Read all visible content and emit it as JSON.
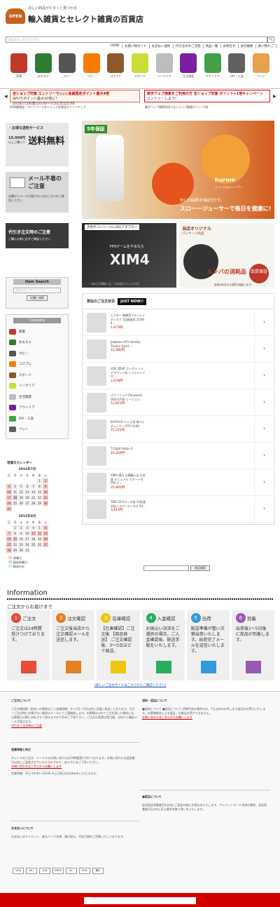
{
  "header": {
    "logo": "OPEN",
    "tagline": "ほしい商品がピタッと見つかる",
    "title": "輸入雑貨とセレクト雑貨の百貨店",
    "search_placeholder": "商品名を入れてください",
    "search_button": "🔍",
    "nav": [
      "HOME",
      "お買い物ガイド",
      "お支払い送料",
      "代引注文のご注意",
      "商品一覧",
      "お問合せ",
      "会社概要",
      "買い物かご"
    ]
  },
  "categories": [
    {
      "label": "家電",
      "color": "#c0392b"
    },
    {
      "label": "おもちゃ",
      "color": "#2e7d32"
    },
    {
      "label": "ホビー",
      "color": "#555555"
    },
    {
      "label": "ベビー",
      "color": "#f57c00"
    },
    {
      "label": "コスプレ",
      "color": "#8e5a2b"
    },
    {
      "label": "スポーツ",
      "color": "#cddc39"
    },
    {
      "label": "インテリア",
      "color": "#bdbdbd"
    },
    {
      "label": "生活雑貨",
      "color": "#7b1fa2"
    },
    {
      "label": "アウトドア",
      "color": "#43a047"
    },
    {
      "label": "DIY・工具",
      "color": "#616161"
    },
    {
      "label": "ペット",
      "color": "#e6a24d"
    }
  ],
  "banners": {
    "left_main": "全ショップ対象 エントリーで◎◎◎会員限定ポイント最大4倍",
    "left_sub": "SPUでポイント最大10倍に!",
    "left_note": "61時間限定・エントリーで全ショップ全商品ポイントアップ",
    "left_date": "2016/7/29(金)10:00〜7/31(日)23:59",
    "right_main": "楽天ウェブ検索をご利用の方 全ショップ対象 ポイント+1倍キャンペーン",
    "right_button": "エントリーしよう!",
    "right_note": "楽天ウェブ検索利用で全ショップ最後ポイント2倍",
    "arrow_prev": "◀",
    "arrow_next": "▶"
  },
  "sidebar": {
    "service1_title": "・お得な送料サービス",
    "service1_amount": "10,000円",
    "service1_cond": "以上ご購入で",
    "service1_big": "送料無料",
    "service2_title": "メール不着のご注意",
    "service2_note": "店舗からメールが届かない方はこちらをご確認ください",
    "service3_title": "代引き注文時のご注意",
    "service3_note": "ご購入の前に必ずご確認ください",
    "item_search_head": "Item Search",
    "item_search_placeholder": "商品名を入れてください",
    "item_search_button": "店舗に検索",
    "category_head": "Category",
    "category_items": [
      "家電",
      "おもちゃ",
      "ホビー",
      "コスプレ",
      "スポーツ",
      "インテリア",
      "生活雑貨",
      "アウトドア",
      "DIY・工具",
      "ペット"
    ]
  },
  "calendar": {
    "title": "営業日カレンダー",
    "month1": "2016年7月",
    "month2": "2016年8月",
    "weekdays": [
      "日",
      "月",
      "火",
      "水",
      "木",
      "金",
      "土"
    ],
    "legend": [
      "休業日",
      "配送休業日",
      "配送のみ"
    ]
  },
  "hero": {
    "badge": "5年保証",
    "brand": "hurom",
    "brand_sub": "ヒューロムジューサー",
    "sub": "安心の長期5年保証付です。",
    "main": "スローージューサーで毎日を健康に!"
  },
  "promo_xim": {
    "tag": "次世代コンソールに対応アダプター",
    "line": "FPSゲームをやるなら",
    "big": "XIM4",
    "note": "一部の正規輸入品・日本語マニュアル付"
  },
  "promo_rumba": {
    "title": "当店オリジナル",
    "sub": "パッケージ商品",
    "main": "ルンバの消耗品",
    "seal": "品質保証",
    "note": "自信があるから品質も保証します!"
  },
  "now": {
    "title": "現在のご注文状況",
    "tag": "JUST NOW!!",
    "arrow": "›",
    "items": [
      {
        "name": "ビクター 映像用ブルーレイディスク 1回録画用 25GB 4...",
        "price": "1,673円"
      },
      {
        "name": "Jawbone UP3 Activity Tracker Sand ...",
        "price": "12,480円"
      },
      {
        "name": "VOX 3DVR ゴーグル ヘッドマウント用 ヘッドバンド付 ...",
        "price": "2,678円"
      },
      {
        "name": "パナソニック Panasonic DVD-S700 リージョン...",
        "price": "12,853円"
      },
      {
        "name": "BUFFALO テレビ用 地デジチューナー DTV-S100",
        "price": "15,221円"
      },
      {
        "name": "T-Flight Hotas X",
        "price": "10,269円"
      },
      {
        "name": "XIM4 国内 正規輸入品 日本語 マニュアル サポート付 FPS ゲ...",
        "price": "25,800円"
      },
      {
        "name": "TDK CD-Rデータ用 32倍速対応シルバーディスク 50...",
        "price": "3,614円"
      }
    ]
  },
  "footer_search": {
    "button": "商品検索"
  },
  "info": {
    "heading": "Information",
    "sub": "ご注文からお届けまで",
    "link": "[詳しいご注文ガイドはこちらからご確認ください]",
    "steps": [
      {
        "num": "1",
        "title": "ご注文",
        "desc": "ご注文は24時間受けつけております。",
        "color": "#e74c3c",
        "icon": "cart-icon"
      },
      {
        "num": "2",
        "title": "注文確認",
        "desc": "ご注文後当店から注文確認メールを送信します。",
        "color": "#e67e22",
        "icon": "mail-icon"
      },
      {
        "num": "3",
        "title": "在庫確認",
        "desc": "【在庫確認】ご注文後 【商品発送】 ご注文確認後、3〜5日ほどで発送。",
        "color": "#f1c40f",
        "icon": "list-icon"
      },
      {
        "num": "4",
        "title": "入金確認",
        "desc": "お振込い決済をご選択の場合、ご入金確認後、配送手配をいたします。",
        "color": "#27ae60",
        "icon": "check-icon"
      },
      {
        "num": "5",
        "title": "出荷",
        "desc": "配送準備が整い次第出荷いたします。出荷完了メールを送信いたします。",
        "color": "#3498db",
        "icon": "truck-icon"
      },
      {
        "num": "6",
        "title": "到着",
        "desc": "出荷後1〜5日後に商品が到着します。",
        "color": "#9b59b6",
        "icon": "house-icon"
      }
    ]
  },
  "footer": {
    "b1_title": "ご注文について",
    "b1_text": "ご注文確認後（前払いの場合はご入金確認後）から1日〜3日以内に迅速に発送しております。万が一ご注文時に在庫がない場合はメールにてご連絡致します。※実費は以外でご注文頂いた場合には、当実業日以降に対応させて頂きますので予めご了承下さい。ご注文の変更は受付後、当社から確認メールが届きます。",
    "b1_link": "代引きご注文時のご注意",
    "b2_title": "営業時間と休日",
    "b2_text": "ネットでのご注文・メールでのお問い合わせは24時間受け付けております。お問い合わせは翌営業日以内にご返答させていただきますので、あらかじめご了承ください。",
    "b2_link": "お問い合わせはこちらからお願いします",
    "b2_hours": "営業時間：平日 10:00〜16:00 ※土日祝日はお休みをいただきます。",
    "b3_title": "お支払いについて",
    "b3_text": "お支払いはクレジット、楽天バンク決済、銀行振込、代金引換をご用意いたしております。",
    "b4_title": "送料・返品について",
    "b4_text": "■送料について ■返品について 初期不良の場合のみ、7日以内のお申し出で返品をお受けいたします。お客様都合による返品・交換はお受けできません。",
    "b4_link": "お問い合わせはこちらからお願いします",
    "b5_title": "■返品について",
    "b5_text": "返品商品到着後3日以内にご返金口座にお振込みいたします。クレジットカード決済の場合、返品到着後3日以内に売上請求の取り消しをいたします。",
    "cards": [
      "VISA",
      "MC",
      "JCB",
      "AMEX",
      "DC",
      "BOX",
      "銀行"
    ]
  }
}
